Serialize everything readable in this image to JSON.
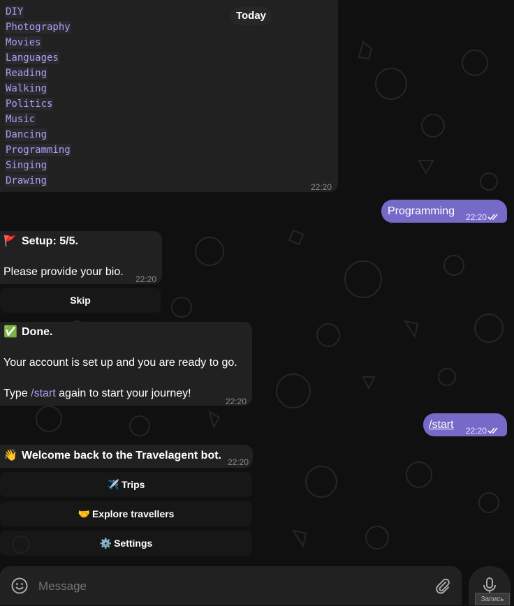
{
  "date_separator": "Today",
  "interests_message": {
    "items": [
      "DIY",
      "Photography",
      "Movies",
      "Languages",
      "Reading",
      "Walking",
      "Politics",
      "Music",
      "Dancing",
      "Programming",
      "Singing",
      "Drawing"
    ],
    "time": "22:20"
  },
  "outgoing_programming": {
    "text": "Programming",
    "time": "22:20"
  },
  "setup_message": {
    "emoji": "🚩",
    "title": "Setup: 5/5.",
    "body": "Please provide your bio.",
    "time": "22:20",
    "skip_label": "Skip"
  },
  "done_message": {
    "emoji": "✅",
    "title": "Done.",
    "line1": "Your account is set up and you are ready to go.",
    "line2_prefix": "Type ",
    "line2_link": "/start",
    "line2_suffix": " again to start your journey!",
    "time": "22:20"
  },
  "outgoing_start": {
    "text": "/start",
    "time": "22:20"
  },
  "welcome_message": {
    "emoji": "👋",
    "text": "Welcome back to the Travelagent bot.",
    "time": "22:20"
  },
  "keyboard": [
    {
      "emoji": "✈️",
      "label": "Trips"
    },
    {
      "emoji": "🤝",
      "label": "Explore travellers"
    },
    {
      "emoji": "⚙️",
      "label": "Settings"
    }
  ],
  "composer": {
    "placeholder": "Message",
    "mic_tooltip": "Запись"
  },
  "colors": {
    "accent": "#766ac8",
    "bubble_in": "#212121",
    "link": "#a99ff2"
  }
}
